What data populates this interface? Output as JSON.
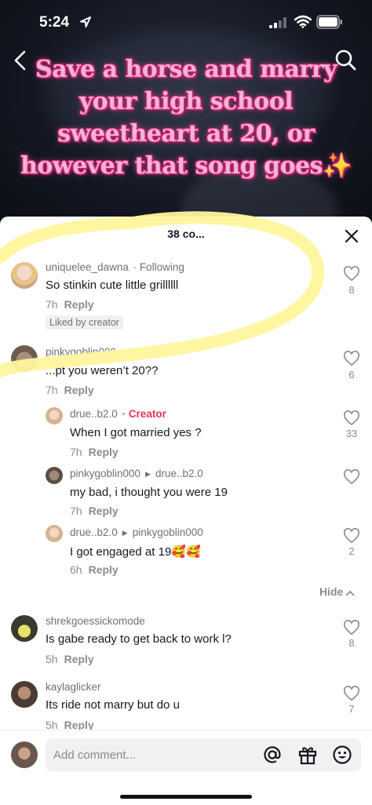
{
  "status_bar": {
    "time": "5:24"
  },
  "video": {
    "caption": "Save a horse and marry your high school sweetheart at 20, or however that song goes✨"
  },
  "comments_sheet": {
    "count_label": "38 co...",
    "hide_label": "Hide",
    "comments": [
      {
        "username": "uniquelee_dawna",
        "tag": "· Following",
        "text": "So stinkin cute little grillllll",
        "time": "7h",
        "reply": "Reply",
        "likes": "8",
        "badge": "Liked by creator"
      },
      {
        "username": "pinkygoblin000",
        "text": "...pt you weren’t 20??",
        "time": "7h",
        "reply": "Reply",
        "likes": "6"
      },
      {
        "username": "drue..b2.0",
        "tag": "· Creator",
        "text": "When I got married yes ?",
        "time": "7h",
        "reply": "Reply",
        "likes": "33"
      },
      {
        "username": "pinkygoblin000",
        "reply_to": "drue..b2.0",
        "text": "my bad, i thought you were 19",
        "time": "7h",
        "reply": "Reply",
        "likes": ""
      },
      {
        "username": "drue..b2.0",
        "reply_to": "pinkygoblin000",
        "text": "I got engaged at 19🥰🥰",
        "time": "6h",
        "reply": "Reply",
        "likes": "2"
      },
      {
        "username": "shrekgoessickomode",
        "text": "Is gabe ready to get back to work l?",
        "time": "5h",
        "reply": "Reply",
        "likes": "8"
      },
      {
        "username": "kaylaglicker",
        "text": "Its ride not marry but do u",
        "time": "5h",
        "reply": "Reply",
        "likes": "7"
      }
    ]
  },
  "input_bar": {
    "placeholder": "Add comment..."
  },
  "colors": {
    "creator_accent": "#e8315a",
    "caption_pink": "#f7b3d2",
    "highlight_yellow": "#fff59d"
  }
}
